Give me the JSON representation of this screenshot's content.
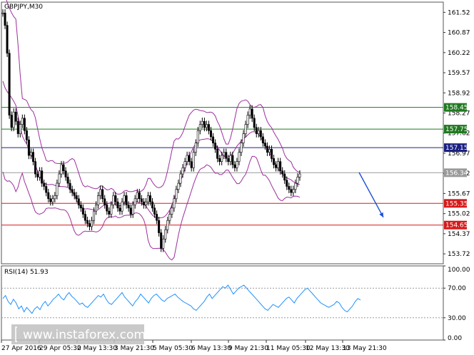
{
  "chart_data": {
    "type": "line",
    "symbol": "GBPJPY,M30",
    "price_axis": {
      "ylim": [
        153.4,
        161.85
      ],
      "ticks": [
        "161.52",
        "160.87",
        "160.22",
        "159.57",
        "158.92",
        "158.27",
        "157.62",
        "156.97",
        "156.32",
        "155.67",
        "155.02",
        "154.37",
        "153.72"
      ]
    },
    "x_ticks": [
      "27 Apr 2016",
      "29 Apr 05:30",
      "2 May 13:30",
      "3 May 21:30",
      "5 May 05:30",
      "6 May 13:30",
      "9 May 21:30",
      "11 May 05:30",
      "12 May 13:30",
      "13 May 21:30"
    ],
    "price_series": {
      "name": "",
      "x": [
        0,
        3,
        6,
        9,
        12,
        15,
        18,
        21,
        24,
        27,
        30,
        33,
        36,
        39,
        42,
        45,
        48,
        51,
        54,
        57,
        60,
        63,
        66,
        69,
        72,
        75,
        78,
        81,
        84,
        87,
        90,
        93,
        96,
        99,
        102,
        105,
        108,
        111,
        114,
        117,
        120,
        123,
        126,
        129,
        132,
        135,
        138,
        141,
        144,
        147,
        150,
        153,
        156,
        159,
        162,
        165,
        168,
        171,
        174,
        177,
        180,
        183,
        186,
        189,
        192,
        195,
        198,
        201,
        204,
        207,
        210,
        213,
        216,
        219,
        222,
        225,
        228,
        231,
        234,
        237,
        240,
        243,
        246,
        249,
        252,
        255,
        258,
        261,
        264,
        267,
        270,
        273,
        276,
        279,
        282,
        285,
        288,
        291,
        294,
        297,
        300,
        303,
        306,
        309,
        312,
        315,
        318,
        321,
        324,
        327,
        330,
        333,
        336,
        339,
        342,
        345,
        348,
        351,
        354,
        357,
        360,
        363,
        366,
        369,
        372,
        375,
        378,
        381,
        384,
        387,
        390,
        393,
        396,
        399,
        402,
        405,
        408,
        411,
        414,
        417,
        420,
        423,
        426,
        429,
        432,
        435,
        438,
        441,
        444,
        447,
        450,
        453,
        456,
        459,
        462,
        465,
        468,
        471,
        474,
        477,
        480,
        483,
        486,
        489,
        492,
        495
      ],
      "y": [
        161.5,
        161.1,
        160.2,
        158.2,
        157.8,
        158.3,
        158.0,
        157.6,
        157.9,
        158.1,
        157.7,
        157.4,
        156.9,
        157.0,
        156.7,
        156.3,
        156.2,
        156.4,
        156.0,
        155.9,
        155.7,
        155.5,
        155.4,
        155.5,
        155.6,
        156.0,
        156.3,
        156.6,
        156.4,
        156.2,
        156.0,
        155.8,
        155.7,
        155.6,
        155.5,
        155.3,
        155.2,
        155.0,
        154.8,
        154.7,
        154.6,
        154.8,
        155.1,
        155.3,
        155.6,
        155.8,
        155.5,
        155.3,
        155.1,
        155.0,
        155.3,
        155.6,
        155.4,
        155.2,
        155.1,
        155.4,
        155.6,
        155.3,
        155.2,
        155.0,
        155.3,
        155.5,
        155.7,
        155.5,
        155.4,
        155.3,
        155.4,
        155.6,
        155.4,
        155.2,
        155.0,
        154.8,
        154.4,
        153.9,
        154.2,
        154.5,
        154.8,
        155.0,
        155.2,
        155.5,
        155.8,
        156.0,
        156.3,
        156.5,
        156.7,
        156.9,
        156.7,
        156.5,
        157.0,
        157.3,
        157.7,
        157.9,
        158.0,
        157.8,
        157.9,
        157.7,
        157.5,
        157.3,
        157.1,
        156.8,
        156.7,
        156.9,
        157.0,
        156.8,
        156.7,
        156.9,
        156.6,
        156.5,
        156.7,
        157.0,
        157.3,
        157.6,
        157.9,
        158.2,
        158.4,
        158.1,
        157.8,
        157.6,
        157.7,
        157.5,
        157.3,
        157.2,
        157.0,
        157.1,
        156.8,
        156.6,
        156.5,
        156.7,
        156.4,
        156.3,
        156.1,
        155.9,
        155.8,
        155.7,
        155.8,
        156.0,
        156.2,
        156.3
      ],
      "color": "#000000"
    },
    "bollinger": {
      "color": "#9c2f9c",
      "upper_offset": 0.75,
      "lower_offset": 0.75
    },
    "levels": [
      {
        "value": 158.45,
        "label": "158.45",
        "color": "#1f7a1f"
      },
      {
        "value": 157.75,
        "label": "157.75",
        "color": "#1f7a1f"
      },
      {
        "value": 157.15,
        "label": "157.15",
        "color": "#1a2080"
      },
      {
        "value": 156.34,
        "label": "156.34",
        "color": "#9a9a9a"
      },
      {
        "value": 155.35,
        "label": "155.35",
        "color": "#d61a1a"
      },
      {
        "value": 154.65,
        "label": "154.65",
        "color": "#d61a1a"
      }
    ],
    "forecast_arrow": {
      "from": [
        503,
        156.35
      ],
      "to": [
        537,
        154.9
      ],
      "color": "#1a4fd6"
    },
    "rsi": {
      "title": "RSI(14) 51.93",
      "ylim": [
        0,
        100
      ],
      "ticks": [
        "100.00",
        "70.00",
        "30.00",
        "0.00"
      ],
      "levels": [
        70,
        30
      ],
      "color": "#1e90ff",
      "values": [
        56,
        60,
        52,
        48,
        55,
        50,
        42,
        46,
        38,
        44,
        40,
        36,
        42,
        45,
        41,
        48,
        52,
        46,
        50,
        55,
        58,
        62,
        57,
        54,
        60,
        64,
        59,
        56,
        52,
        48,
        50,
        46,
        44,
        48,
        52,
        56,
        60,
        58,
        62,
        55,
        50,
        48,
        52,
        56,
        60,
        64,
        58,
        54,
        50,
        46,
        52,
        56,
        62,
        58,
        54,
        50,
        56,
        60,
        62,
        58,
        54,
        52,
        56,
        58,
        60,
        62,
        58,
        55,
        52,
        50,
        48,
        46,
        42,
        40,
        44,
        48,
        52,
        58,
        62,
        56,
        60,
        64,
        68,
        72,
        70,
        74,
        68,
        62,
        66,
        70,
        72,
        74,
        70,
        66,
        62,
        58,
        54,
        50,
        46,
        42,
        40,
        44,
        48,
        46,
        44,
        48,
        52,
        56,
        58,
        54,
        50,
        56,
        60,
        64,
        68,
        70,
        66,
        62,
        58,
        54,
        50,
        48,
        46,
        44,
        46,
        48,
        52,
        50,
        44,
        40,
        38,
        42,
        46,
        52,
        56,
        54
      ]
    },
    "watermark": "www.instaforex.com"
  }
}
